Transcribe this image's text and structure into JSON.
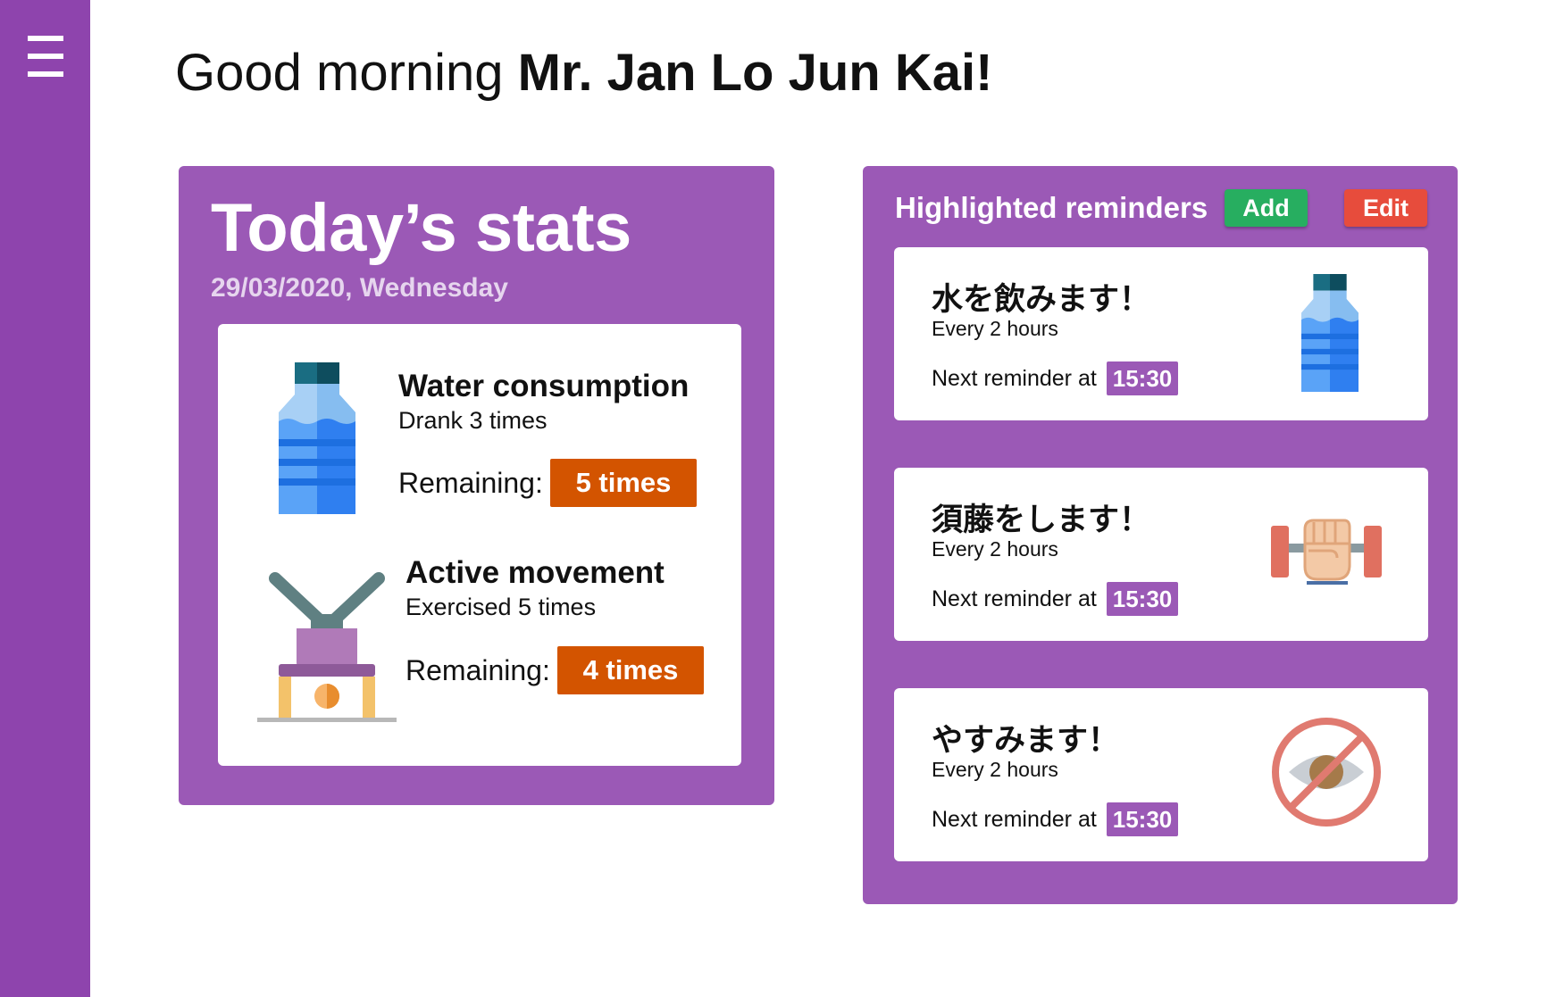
{
  "sidebar": {
    "menu_icon": "hamburger-menu-icon"
  },
  "greeting": {
    "prefix": "Good morning ",
    "name": "Mr. Jan Lo Jun Kai!"
  },
  "stats": {
    "title": "Today’s stats",
    "date": "29/03/2020, Wednesday",
    "items": [
      {
        "icon": "water-bottle-icon",
        "title": "Water consumption",
        "sub": "Drank 3 times",
        "remaining_label": "Remaining:",
        "remaining_value": "5 times"
      },
      {
        "icon": "exercise-icon",
        "title": "Active movement",
        "sub": "Exercised 5 times",
        "remaining_label": "Remaining:",
        "remaining_value": "4 times"
      }
    ]
  },
  "reminders": {
    "title": "Highlighted reminders",
    "add_label": "Add",
    "edit_label": "Edit",
    "items": [
      {
        "name": "水を飲みます！",
        "freq": "Every 2 hours",
        "next_label": "Next reminder at",
        "time": "15:30",
        "icon": "water-bottle-icon"
      },
      {
        "name": "須藤をします！",
        "freq": "Every 2 hours",
        "next_label": "Next reminder at",
        "time": "15:30",
        "icon": "dumbbell-fist-icon"
      },
      {
        "name": "やすみます！",
        "freq": "Every 2 hours",
        "next_label": "Next reminder at",
        "time": "15:30",
        "icon": "no-eye-icon"
      }
    ]
  },
  "colors": {
    "sidebar": "#8e44ad",
    "card": "#9b59b6",
    "badge_orange": "#d35400",
    "add_button": "#27ae60",
    "edit_button": "#e74c3c"
  }
}
